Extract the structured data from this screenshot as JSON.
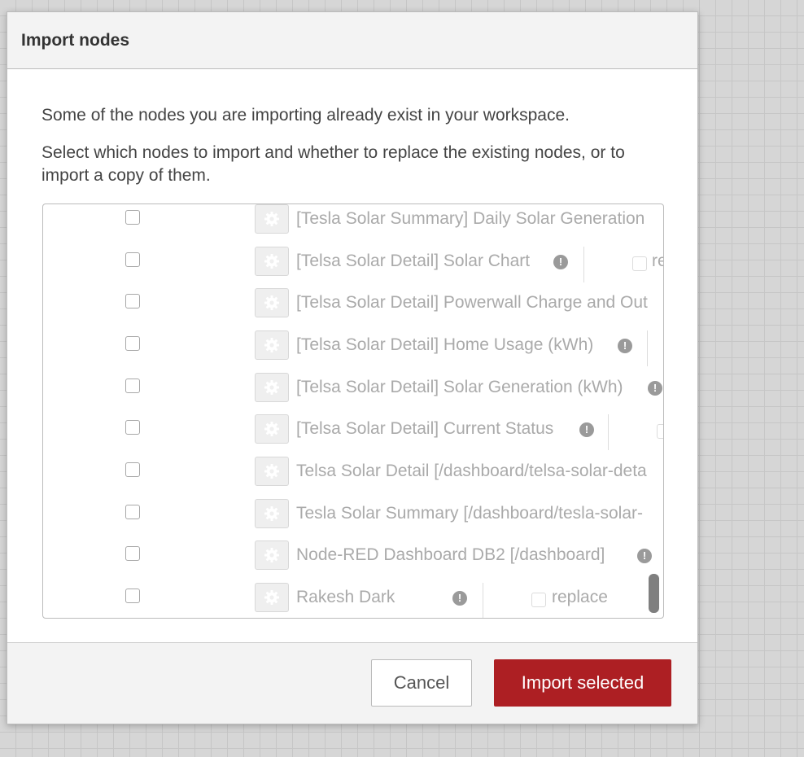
{
  "dialog": {
    "title": "Import nodes",
    "message_1": "Some of the nodes you are importing already exist in your workspace.",
    "message_2": "Select which nodes to import and whether to replace the existing nodes, or to import a copy of them."
  },
  "nodes": [
    {
      "label": "[Tesla Solar Summary] Daily Solar Generation",
      "warn": false,
      "replace_label": ""
    },
    {
      "label": "[Telsa Solar Detail] Solar Chart",
      "warn": true,
      "replace_label": "re"
    },
    {
      "label": "[Telsa Solar Detail] Powerwall Charge and Out",
      "warn": false,
      "replace_label": ""
    },
    {
      "label": "[Telsa Solar Detail] Home Usage (kWh)",
      "warn": true,
      "replace_label": ""
    },
    {
      "label": "[Telsa Solar Detail] Solar Generation (kWh)",
      "warn": true,
      "replace_label": ""
    },
    {
      "label": "[Telsa Solar Detail] Current Status",
      "warn": true,
      "replace_label": ""
    },
    {
      "label": "Telsa Solar Detail [/dashboard/telsa-solar-deta",
      "warn": false,
      "replace_label": ""
    },
    {
      "label": "Tesla Solar Summary [/dashboard/tesla-solar-",
      "warn": false,
      "replace_label": ""
    },
    {
      "label": "Node-RED Dashboard DB2 [/dashboard]",
      "warn": true,
      "replace_label": ""
    },
    {
      "label": "Rakesh Dark",
      "warn": true,
      "replace_label": "replace"
    }
  ],
  "footer": {
    "cancel_label": "Cancel",
    "import_label": "Import selected"
  },
  "icons": {
    "gear": "gear-icon",
    "warning": "exclamation-circle-icon"
  },
  "colors": {
    "primary_button": "#ad1f23",
    "canvas_background": "#d6d6d6"
  }
}
